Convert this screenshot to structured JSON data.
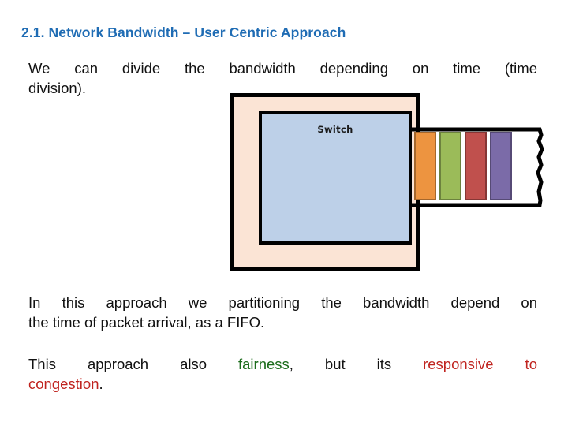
{
  "slide": {
    "title": "2.1. Network Bandwidth – User Centric Approach",
    "paragraph_1": {
      "line_1": "We can divide the bandwidth depending on time (time",
      "line_2": "division)."
    },
    "paragraph_2": {
      "line_1": "In this approach we partitioning the bandwidth depend on",
      "line_2": "the time of packet arrival, as a FIFO."
    },
    "paragraph_3": {
      "seg_1": "This approach also ",
      "seg_2_green": "fairness",
      "seg_3": ", but its ",
      "seg_4_red": "responsive to",
      "seg_5_red": "congestion",
      "seg_6": "."
    }
  },
  "diagram": {
    "switch_label": "Switch",
    "chassis_color": "#fbe4d5",
    "inner_color": "#bdd0e8",
    "outline_color": "#000000",
    "packets": [
      {
        "name": "packet-orange",
        "color": "#ed9440"
      },
      {
        "name": "packet-green",
        "color": "#9bbb59"
      },
      {
        "name": "packet-red",
        "color": "#c0504d"
      },
      {
        "name": "packet-purple",
        "color": "#7b6ba8"
      }
    ]
  },
  "colors": {
    "title_blue": "#1f6cb4",
    "keyword_green": "#1a6b1a",
    "keyword_red": "#c0241f",
    "body_text": "#111111"
  }
}
